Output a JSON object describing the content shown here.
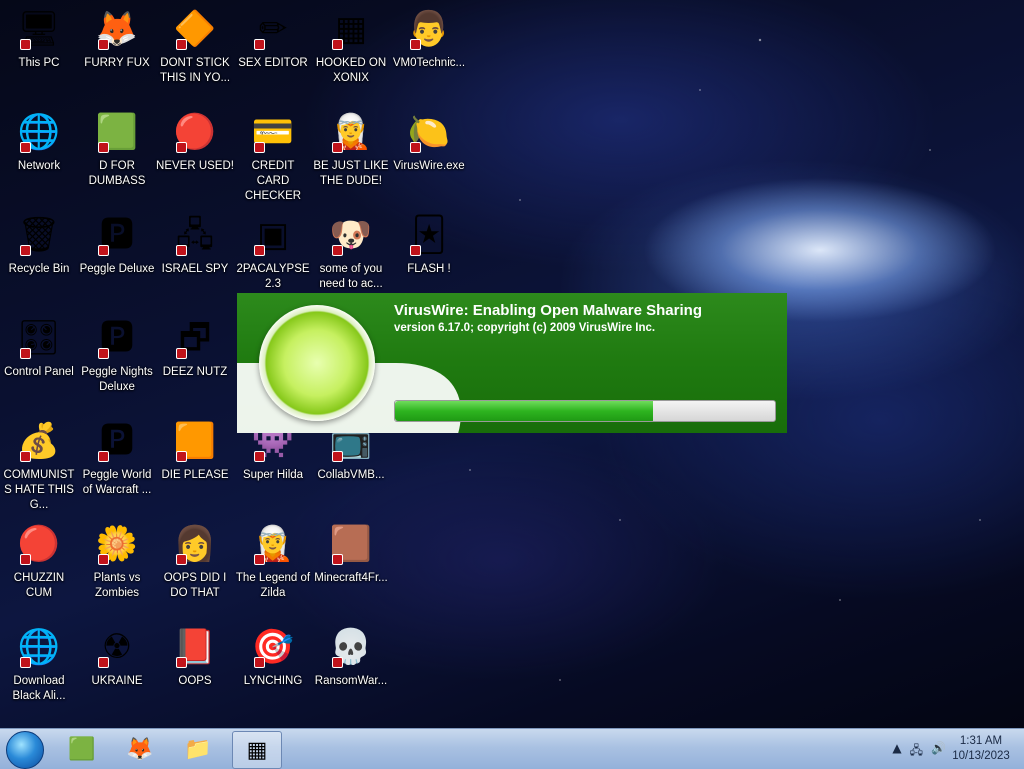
{
  "desktop": {
    "icons": [
      {
        "id": "this-pc",
        "label": "This PC",
        "glyph": "🖥"
      },
      {
        "id": "furry-fux",
        "label": "FURRY FUX",
        "glyph": "🦊"
      },
      {
        "id": "dont-stick",
        "label": "DONT STICK THIS IN YO...",
        "glyph": "🔶"
      },
      {
        "id": "sex-editor",
        "label": "SEX EDITOR",
        "glyph": "✏"
      },
      {
        "id": "hooked-on-xonix",
        "label": "HOOKED ON XONIX",
        "glyph": "▦"
      },
      {
        "id": "vm0technic",
        "label": "VM0Technic...",
        "glyph": "👨"
      },
      {
        "id": "network",
        "label": "Network",
        "glyph": "🌐"
      },
      {
        "id": "d-for-dumbass",
        "label": "D FOR DUMBASS",
        "glyph": "🟩"
      },
      {
        "id": "never-used",
        "label": "NEVER USED!",
        "glyph": "🔴"
      },
      {
        "id": "credit-card-checker",
        "label": "CREDIT CARD CHECKER",
        "glyph": "💳"
      },
      {
        "id": "be-just-like-the-dude",
        "label": "BE JUST LIKE THE DUDE!",
        "glyph": "🧝"
      },
      {
        "id": "viruswire-exe",
        "label": "VirusWire.exe",
        "glyph": "🍋"
      },
      {
        "id": "recycle-bin",
        "label": "Recycle Bin",
        "glyph": "🗑"
      },
      {
        "id": "peggle-deluxe",
        "label": "Peggle Deluxe",
        "glyph": "🅿"
      },
      {
        "id": "israel-spy",
        "label": "ISRAEL SPY",
        "glyph": "🖧"
      },
      {
        "id": "2pacalypse",
        "label": "2PACALYPSE 2.3",
        "glyph": "▣"
      },
      {
        "id": "some-of-you",
        "label": "some of you need to ac...",
        "glyph": "🐶"
      },
      {
        "id": "flash",
        "label": "FLASH !",
        "glyph": "🃏"
      },
      {
        "id": "control-panel",
        "label": "Control Panel",
        "glyph": "🎛"
      },
      {
        "id": "peggle-nights",
        "label": "Peggle Nights Deluxe",
        "glyph": "🅿"
      },
      {
        "id": "deez-nutz",
        "label": "DEEZ NUTZ",
        "glyph": "🗗"
      },
      {
        "id": "communists",
        "label": "COMMUNISTS HATE THIS G...",
        "glyph": "💰"
      },
      {
        "id": "peggle-world",
        "label": "Peggle World of Warcraft ...",
        "glyph": "🅿"
      },
      {
        "id": "die-please",
        "label": "DIE PLEASE",
        "glyph": "🟧"
      },
      {
        "id": "super-hilda",
        "label": "Super Hilda",
        "glyph": "👾"
      },
      {
        "id": "collabvmb",
        "label": "CollabVMB...",
        "glyph": "📺"
      },
      {
        "id": "chuzzin-cum",
        "label": "CHUZZIN CUM",
        "glyph": "🔴"
      },
      {
        "id": "plants-vs-zombies",
        "label": "Plants vs Zombies",
        "glyph": "🌼"
      },
      {
        "id": "oops-did-i",
        "label": "OOPS DID I DO THAT",
        "glyph": "👩"
      },
      {
        "id": "legend-of-zilda",
        "label": "The Legend of Zilda",
        "glyph": "🧝"
      },
      {
        "id": "minecraft4fr",
        "label": "Minecraft4Fr...",
        "glyph": "🟫"
      },
      {
        "id": "download-black-ali",
        "label": "Download Black Ali...",
        "glyph": "🌐"
      },
      {
        "id": "ukraine",
        "label": "UKRAINE",
        "glyph": "☢"
      },
      {
        "id": "oops",
        "label": "OOPS",
        "glyph": "📕"
      },
      {
        "id": "lynching",
        "label": "LYNCHING",
        "glyph": "🎯"
      },
      {
        "id": "ransomwar",
        "label": "RansomWar...",
        "glyph": "💀"
      }
    ]
  },
  "splash": {
    "title": "VirusWire: Enabling Open Malware Sharing",
    "version": "version 6.17.0; copyright (c) 2009 VirusWire Inc.",
    "progress": 0.68
  },
  "taskbar": {
    "apps": [
      {
        "id": "taskbar-d-for-dumbass",
        "glyph": "🟩"
      },
      {
        "id": "taskbar-firefox",
        "glyph": "🦊"
      },
      {
        "id": "taskbar-explorer",
        "glyph": "📁"
      },
      {
        "id": "taskbar-viruswire",
        "glyph": "▦"
      }
    ],
    "tray": {
      "arrow": "▲",
      "network": "🖧",
      "volume": "🔊"
    },
    "clock": {
      "time": "1:31 AM",
      "date": "10/13/2023"
    }
  }
}
